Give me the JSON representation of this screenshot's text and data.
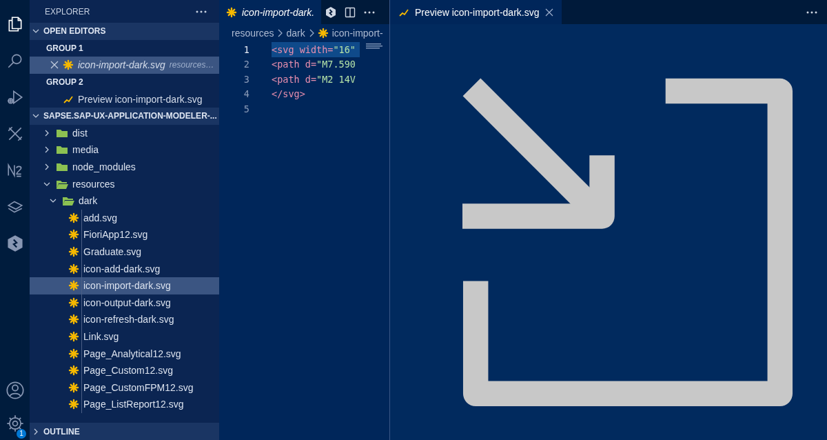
{
  "activity_bar": {
    "items": [
      {
        "kind": "files",
        "selected": true
      },
      {
        "kind": "search",
        "selected": false
      },
      {
        "kind": "debug",
        "selected": false
      },
      {
        "kind": "tools",
        "selected": false
      },
      {
        "kind": "n2",
        "selected": false
      },
      {
        "kind": "layers",
        "selected": false
      },
      {
        "kind": "hex",
        "selected": false
      }
    ],
    "bottom": [
      {
        "kind": "account",
        "selected": false
      },
      {
        "kind": "settings",
        "selected": false,
        "badge": "1"
      }
    ]
  },
  "sidebar": {
    "title": "EXPLORER",
    "open_editors": {
      "label": "OPEN EDITORS",
      "expanded": true,
      "groups": [
        {
          "label": "GROUP 1",
          "items": [
            {
              "name": "icon-import-dark.svg",
              "description": "resources…",
              "kind": "svg",
              "preview": true,
              "close": true,
              "selected": true
            }
          ]
        },
        {
          "label": "GROUP 2",
          "items": [
            {
              "name": "Preview icon-import-dark.svg",
              "kind": "preview",
              "preview": false,
              "close": false,
              "selected": false
            }
          ]
        }
      ]
    },
    "tree": {
      "label": "SAPSE.SAP-UX-APPLICATION-MODELER-...",
      "expanded": true,
      "children": [
        {
          "name": "dist",
          "kind": "folder",
          "expanded": false
        },
        {
          "name": "media",
          "kind": "folder",
          "expanded": false
        },
        {
          "name": "node_modules",
          "kind": "folder",
          "expanded": false
        },
        {
          "name": "resources",
          "kind": "folder",
          "expanded": true,
          "children": [
            {
              "name": "dark",
              "kind": "folder",
              "expanded": true,
              "children": [
                {
                  "name": "add.svg",
                  "kind": "svg",
                  "selected": false
                },
                {
                  "name": "FioriApp12.svg",
                  "kind": "svg",
                  "selected": false
                },
                {
                  "name": "Graduate.svg",
                  "kind": "svg",
                  "selected": false
                },
                {
                  "name": "icon-add-dark.svg",
                  "kind": "svg",
                  "selected": false
                },
                {
                  "name": "icon-import-dark.svg",
                  "kind": "svg",
                  "selected": true
                },
                {
                  "name": "icon-output-dark.svg",
                  "kind": "svg",
                  "selected": false
                },
                {
                  "name": "icon-refresh-dark.svg",
                  "kind": "svg",
                  "selected": false
                },
                {
                  "name": "Link.svg",
                  "kind": "svg",
                  "selected": false
                },
                {
                  "name": "Page_Analytical12.svg",
                  "kind": "svg",
                  "selected": false
                },
                {
                  "name": "Page_Custom12.svg",
                  "kind": "svg",
                  "selected": false
                },
                {
                  "name": "Page_CustomFPM12.svg",
                  "kind": "svg",
                  "selected": false
                },
                {
                  "name": "Page_ListReport12.svg",
                  "kind": "svg",
                  "selected": false
                }
              ]
            }
          ]
        }
      ]
    },
    "outline": {
      "label": "OUTLINE",
      "expanded": false
    }
  },
  "editor_left": {
    "tab": {
      "label": "icon-import-dark.",
      "kind": "svg",
      "preview": true,
      "selected": true
    },
    "breadcrumbs": [
      {
        "label": "resources"
      },
      {
        "label": "dark"
      },
      {
        "label": "icon-import-",
        "kind": "svg"
      }
    ],
    "lines": [
      {
        "number": "1",
        "current": true,
        "tokens": [
          {
            "text": "<svg width=",
            "kind": "tag"
          },
          {
            "text": "\"16\"",
            "kind": "string"
          }
        ]
      },
      {
        "number": "2",
        "current": false,
        "tokens": [
          {
            "text": "<path d=",
            "kind": "tag"
          },
          {
            "text": "\"M7.590",
            "kind": "string"
          }
        ]
      },
      {
        "number": "3",
        "current": false,
        "tokens": [
          {
            "text": "<path d=",
            "kind": "tag"
          },
          {
            "text": "\"M2 14V",
            "kind": "string"
          }
        ]
      },
      {
        "number": "4",
        "current": false,
        "tokens": [
          {
            "text": "</svg>",
            "kind": "tag"
          }
        ]
      },
      {
        "number": "5",
        "current": false
      }
    ]
  },
  "editor_right": {
    "tab": {
      "label": "Preview icon-import-dark.svg",
      "kind": "preview",
      "preview": false,
      "selected": true,
      "close": true
    }
  }
}
